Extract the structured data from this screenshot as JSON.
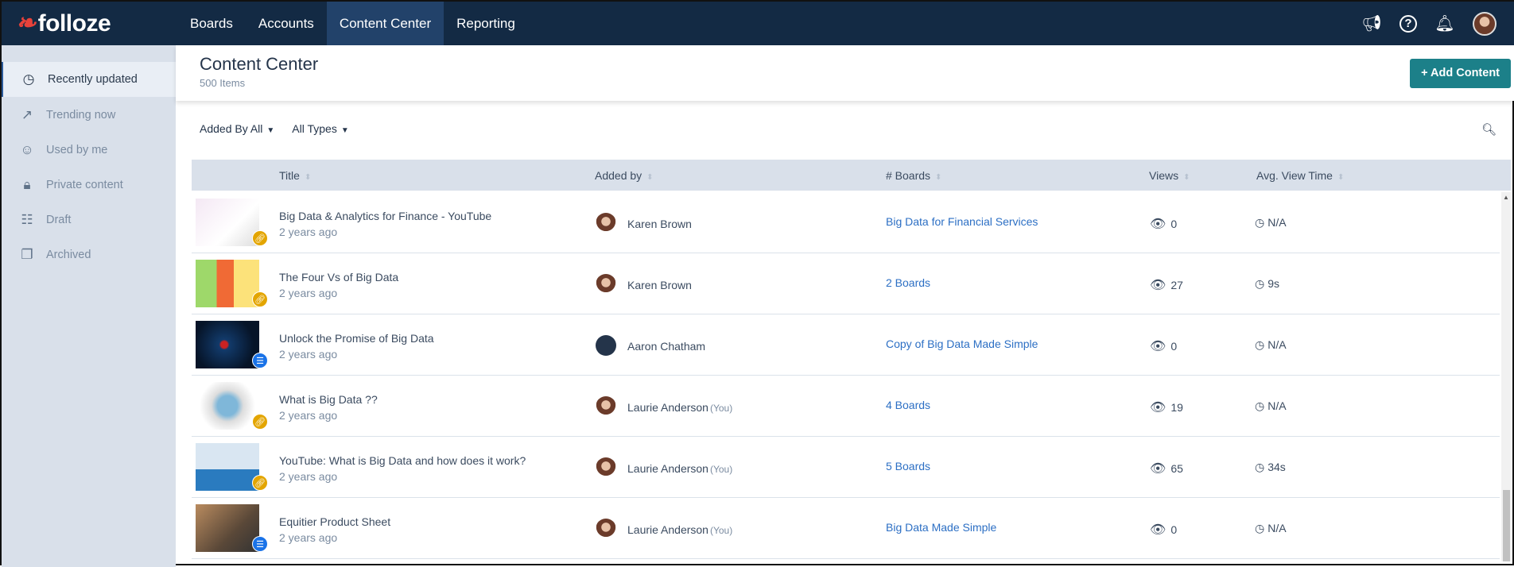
{
  "brand": {
    "name": "folloze"
  },
  "nav": {
    "items": [
      {
        "label": "Boards"
      },
      {
        "label": "Accounts"
      },
      {
        "label": "Content Center",
        "active": true
      },
      {
        "label": "Reporting"
      }
    ]
  },
  "sidebar": {
    "items": [
      {
        "label": "Recently updated",
        "icon": "clock-icon",
        "active": true
      },
      {
        "label": "Trending now",
        "icon": "trending-icon"
      },
      {
        "label": "Used by me",
        "icon": "user-icon"
      },
      {
        "label": "Private content",
        "icon": "lock-icon"
      },
      {
        "label": "Draft",
        "icon": "draft-icon"
      },
      {
        "label": "Archived",
        "icon": "archive-icon"
      }
    ]
  },
  "header": {
    "title": "Content Center",
    "count": "500 Items",
    "add_label": "+ Add Content"
  },
  "filters": {
    "added_by": "Added By All",
    "types": "All Types"
  },
  "table": {
    "columns": [
      "Title",
      "Added by",
      "# Boards",
      "Views",
      "Avg. View Time"
    ],
    "rows": [
      {
        "title": "Big Data & Analytics for Finance - YouTube",
        "date": "2 years ago",
        "added_by": "Karen Brown",
        "you": "",
        "boards": "Big Data for Financial Services",
        "views": "0",
        "time": "N/A",
        "type": "link"
      },
      {
        "title": "The Four Vs of Big Data",
        "date": "2 years ago",
        "added_by": "Karen Brown",
        "you": "",
        "boards": "2 Boards",
        "views": "27",
        "time": "9s",
        "type": "link"
      },
      {
        "title": "Unlock the Promise of Big Data",
        "date": "2 years ago",
        "added_by": "Aaron Chatham",
        "you": "",
        "boards": "Copy of Big Data Made Simple",
        "views": "0",
        "time": "N/A",
        "type": "doc"
      },
      {
        "title": "What is Big Data ??",
        "date": "2 years ago",
        "added_by": "Laurie Anderson",
        "you": "(You)",
        "boards": "4 Boards",
        "views": "19",
        "time": "N/A",
        "type": "link"
      },
      {
        "title": "YouTube: What is Big Data and how does it work?",
        "date": "2 years ago",
        "added_by": "Laurie Anderson",
        "you": "(You)",
        "boards": "5 Boards",
        "views": "65",
        "time": "34s",
        "type": "link"
      },
      {
        "title": "Equitier Product Sheet",
        "date": "2 years ago",
        "added_by": "Laurie Anderson",
        "you": "(You)",
        "boards": "Big Data Made Simple",
        "views": "0",
        "time": "N/A",
        "type": "doc"
      }
    ]
  },
  "colors": {
    "nav": "#132a44",
    "accent": "#1c8089",
    "link": "#2c6fc4",
    "link_badge": "#e3a500",
    "doc_badge": "#1a73e8"
  }
}
